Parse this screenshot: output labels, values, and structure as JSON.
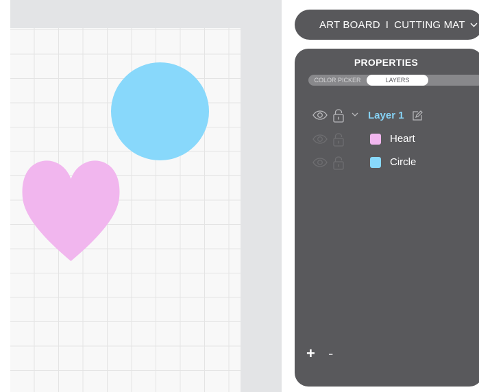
{
  "canvas": {
    "shapes": [
      {
        "name": "Circle",
        "type": "circle",
        "color": "#88d8fb"
      },
      {
        "name": "Heart",
        "type": "heart",
        "color": "#f1b6ee"
      }
    ]
  },
  "header": {
    "artboard_label": "ART BOARD",
    "separator": "I",
    "mat_label": "CUTTING MAT",
    "dropdown_icon": "chevron-down-icon"
  },
  "properties": {
    "title": "PROPERTIES",
    "tabs": [
      {
        "label": "COLOR PICKER",
        "active": false
      },
      {
        "label": "LAYERS",
        "active": true
      }
    ],
    "layer_group": {
      "label": "Layer 1",
      "icons": [
        "eye-icon",
        "lock-open-icon",
        "chevron-down-icon",
        "edit-icon"
      ],
      "color": "#86d2f5"
    },
    "items": [
      {
        "label": "Heart",
        "color": "#f1b6ee"
      },
      {
        "label": "Circle",
        "color": "#88d8fb"
      }
    ],
    "footer": {
      "add_label": "+",
      "remove_label": "-"
    }
  }
}
